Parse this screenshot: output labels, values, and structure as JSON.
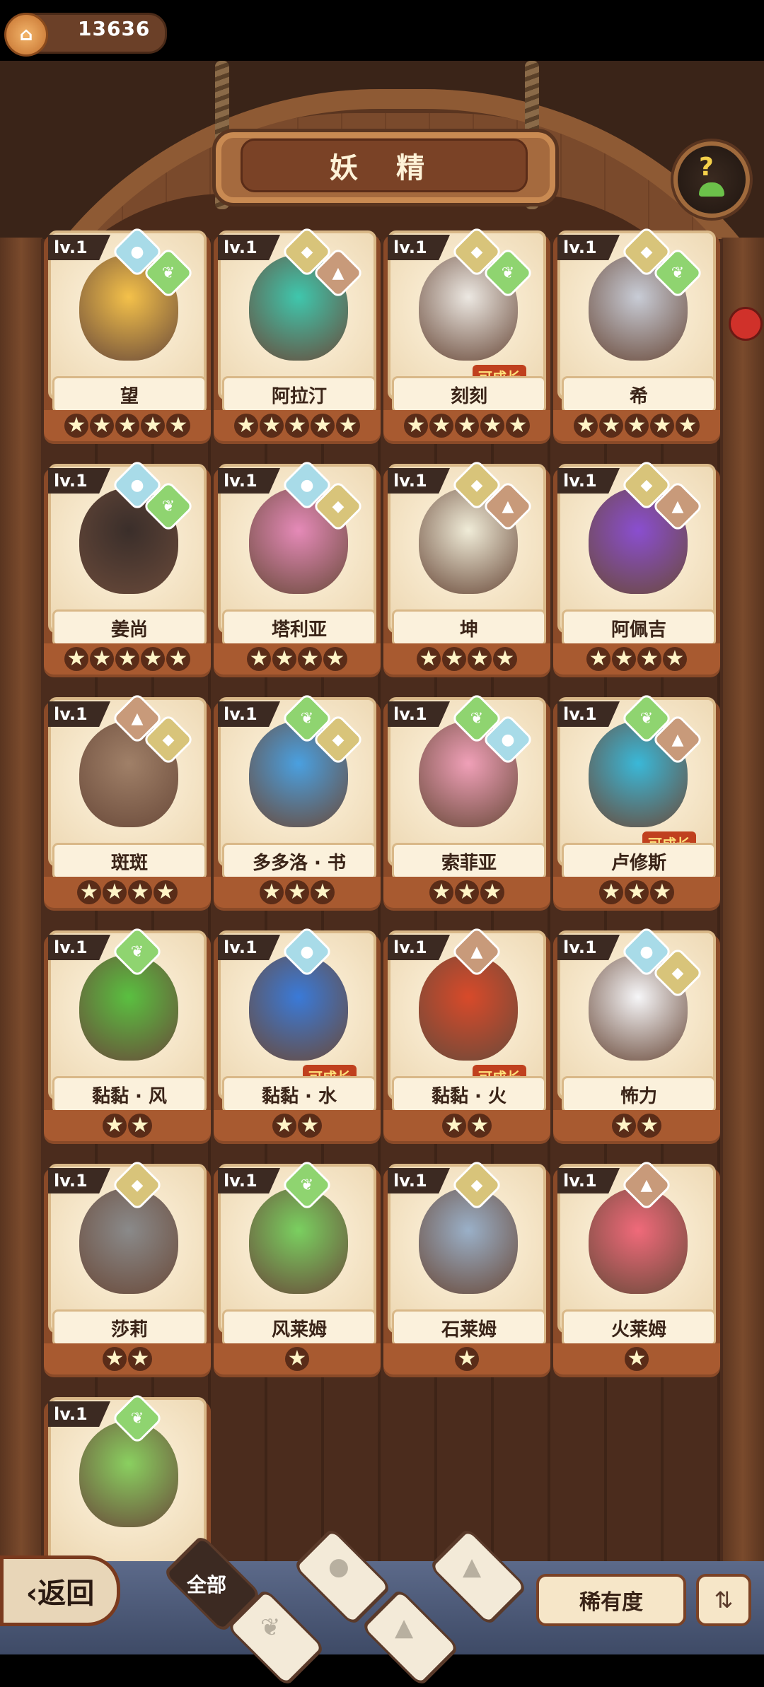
{
  "header": {
    "coin_value": "13636",
    "title": "妖 精"
  },
  "elements": {
    "water": {
      "icon": "water-drop-icon",
      "color": "#a8dbe8"
    },
    "earth": {
      "icon": "rock-icon",
      "color": "#d8c47a"
    },
    "fire": {
      "icon": "mountain-icon",
      "color": "#c89a7a"
    },
    "wind": {
      "icon": "sprout-icon",
      "color": "#8fd470"
    }
  },
  "cards": [
    {
      "level": "lv.1",
      "name": "望",
      "stars": 5,
      "growable": false,
      "badge": ""
    },
    {
      "level": "lv.1",
      "name": "阿拉汀",
      "stars": 5,
      "growable": false,
      "badge": ""
    },
    {
      "level": "lv.1",
      "name": "刻刻",
      "stars": 5,
      "growable": true,
      "badge": "可成长"
    },
    {
      "level": "lv.1",
      "name": "希",
      "stars": 5,
      "growable": false,
      "badge": ""
    },
    {
      "level": "lv.1",
      "name": "姜尚",
      "stars": 5,
      "growable": false,
      "badge": ""
    },
    {
      "level": "lv.1",
      "name": "塔利亚",
      "stars": 4,
      "growable": false,
      "badge": ""
    },
    {
      "level": "lv.1",
      "name": "坤",
      "stars": 4,
      "growable": false,
      "badge": ""
    },
    {
      "level": "lv.1",
      "name": "阿佩吉",
      "stars": 4,
      "growable": false,
      "badge": ""
    },
    {
      "level": "lv.1",
      "name": "斑斑",
      "stars": 4,
      "growable": false,
      "badge": ""
    },
    {
      "level": "lv.1",
      "name": "多多洛 · 书",
      "stars": 3,
      "growable": false,
      "badge": ""
    },
    {
      "level": "lv.1",
      "name": "索菲亚",
      "stars": 3,
      "growable": false,
      "badge": ""
    },
    {
      "level": "lv.1",
      "name": "卢修斯",
      "stars": 3,
      "growable": true,
      "badge": "可成长"
    },
    {
      "level": "lv.1",
      "name": "黏黏 · 风",
      "stars": 2,
      "growable": false,
      "badge": ""
    },
    {
      "level": "lv.1",
      "name": "黏黏 · 水",
      "stars": 2,
      "growable": true,
      "badge": "可成长"
    },
    {
      "level": "lv.1",
      "name": "黏黏 · 火",
      "stars": 2,
      "growable": true,
      "badge": "可成长"
    },
    {
      "level": "lv.1",
      "name": "怖力",
      "stars": 2,
      "growable": false,
      "badge": ""
    },
    {
      "level": "lv.1",
      "name": "莎莉",
      "stars": 2,
      "growable": false,
      "badge": ""
    },
    {
      "level": "lv.1",
      "name": "风莱姆",
      "stars": 1,
      "growable": false,
      "badge": ""
    },
    {
      "level": "lv.1",
      "name": "石莱姆",
      "stars": 1,
      "growable": false,
      "badge": ""
    },
    {
      "level": "lv.1",
      "name": "火莱姆",
      "stars": 1,
      "growable": false,
      "badge": ""
    },
    {
      "level": "lv.1",
      "name": "",
      "stars": 0,
      "growable": false,
      "badge": ""
    }
  ],
  "bottom": {
    "back_label": "返回",
    "filter_all_label": "全部",
    "rarity_label": "稀有度",
    "filters": [
      "wind-sprout-icon",
      "water-drop-icon",
      "earth-icon",
      "fire-mountain-icon"
    ]
  },
  "colors": {
    "card_frame": "#a85a30",
    "card_bg": "#f6e6c8",
    "grow_badge": "#c0401e"
  }
}
